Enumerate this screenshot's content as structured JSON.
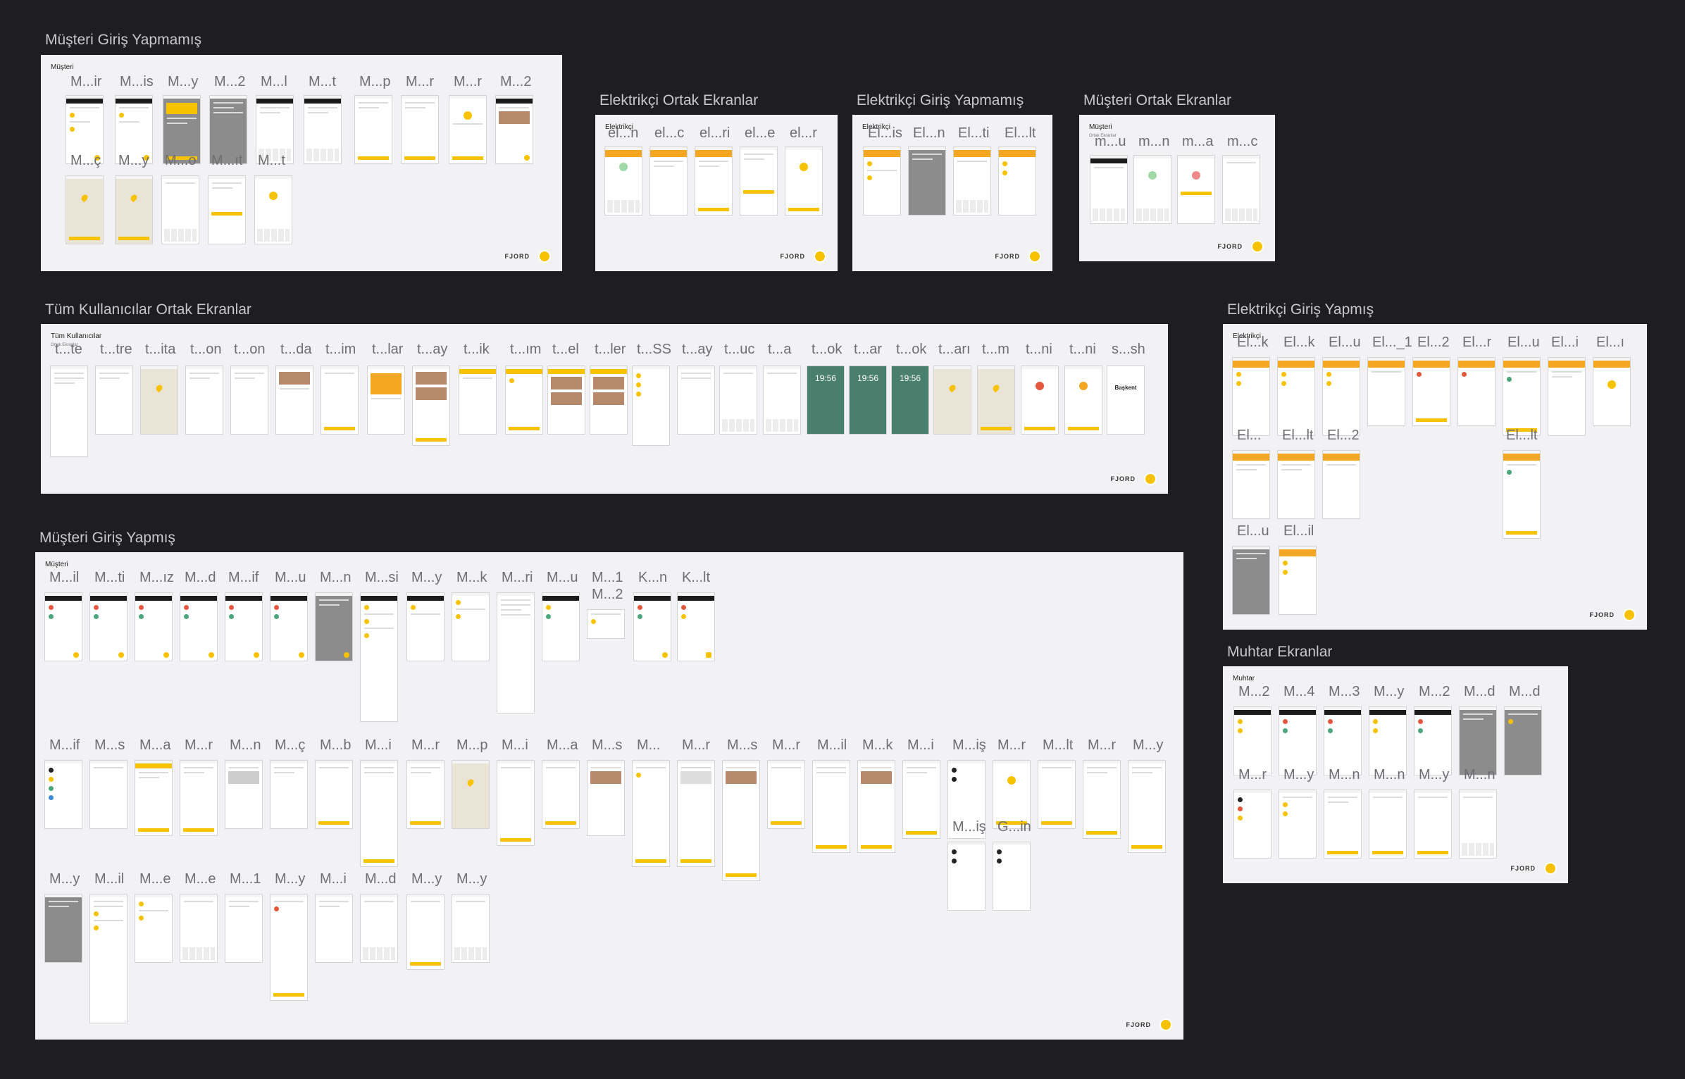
{
  "brand": {
    "logo_text": "FJORD"
  },
  "boards": [
    {
      "title": "Müşteri Giriş Yapmamış",
      "subtitle": "Müşteri",
      "subnote": "",
      "labels": [
        "M...ir",
        "M...is",
        "M...y",
        "M...2",
        "M...l",
        "M...t",
        "M...p",
        "M...r",
        "M...r",
        "M...2",
        "M...ç",
        "M...y",
        "M...o",
        "M...ıt",
        "M...t"
      ]
    },
    {
      "title": "Elektrikçi Ortak Ekranlar",
      "subtitle": "Elektrikçi",
      "subnote": "",
      "labels": [
        "el...n",
        "el...c",
        "el...ri",
        "el...e",
        "el...r"
      ]
    },
    {
      "title": "Elektrikçi Giriş Yapmamış",
      "subtitle": "Elektrikçi",
      "subnote": "",
      "labels": [
        "El...is",
        "El...n",
        "El...ti",
        "El...lt"
      ]
    },
    {
      "title": "Müşteri Ortak Ekranlar",
      "subtitle": "Müşteri",
      "subnote": "Ortak Ekranlar",
      "labels": [
        "m...u",
        "m...n",
        "m...a",
        "m...c"
      ]
    },
    {
      "title": "Tüm Kullanıcılar Ortak Ekranlar",
      "subtitle": "Tüm Kullanıcılar",
      "subnote": "Ortak Ekranlar",
      "labels": [
        "t...te",
        "t...tre",
        "t...ita",
        "t...on",
        "t...on",
        "t...da",
        "t...im",
        "t...lar",
        "t...ay",
        "t...ik",
        "t...ım",
        "t...el",
        "t...ler",
        "t...SS",
        "t...ay",
        "t...uc",
        "t...a",
        "t...ok",
        "t...ar",
        "t...ok",
        "t...arı",
        "t...m",
        "t...ni",
        "t...ni",
        "s...sh"
      ],
      "lock_time": "19:56",
      "brand_screen": "Başkent"
    },
    {
      "title": "Elektrikçi Giriş Yapmış",
      "subtitle": "Elektrikçi",
      "subnote": "",
      "labels": [
        "El...k",
        "El...k",
        "El...u",
        "El..._1",
        "El...2",
        "El...r",
        "El...u",
        "El...i",
        "El...ı",
        "El...",
        "El...lt",
        "El...2",
        "El...lt",
        "El...u",
        "El...il"
      ]
    },
    {
      "title": "Müşteri Giriş Yapmış",
      "subtitle": "Müşteri",
      "subnote": "",
      "labels": [
        "M...il",
        "M...ti",
        "M...ız",
        "M...d",
        "M...if",
        "M...u",
        "M...n",
        "M...si",
        "M...y",
        "M...k",
        "M...ri",
        "M...u",
        "M...1",
        "M...2",
        "K...n",
        "K...lt",
        "M...if",
        "M...s",
        "M...a",
        "M...r",
        "M...n",
        "M...ç",
        "M...b",
        "M...i",
        "M...r",
        "M...p",
        "M...i",
        "M...a",
        "M...s",
        "M...",
        "M...r",
        "M...s",
        "M...r",
        "M...il",
        "M...k",
        "M...i",
        "M...iş",
        "M...r",
        "M...lt",
        "M...r",
        "M...y",
        "M...iş",
        "G...in",
        "M...y",
        "M...il",
        "M...e",
        "M...e",
        "M...1",
        "M...y",
        "M...i",
        "M...d",
        "M...y",
        "M...y"
      ]
    },
    {
      "title": "Muhtar Ekranlar",
      "subtitle": "Muhtar",
      "subnote": "",
      "labels": [
        "M...2",
        "M...4",
        "M...3",
        "M...y",
        "M...2",
        "M...d",
        "M...d",
        "M...r",
        "M...y",
        "M...n",
        "M...n",
        "M...y",
        "M...n"
      ]
    }
  ]
}
